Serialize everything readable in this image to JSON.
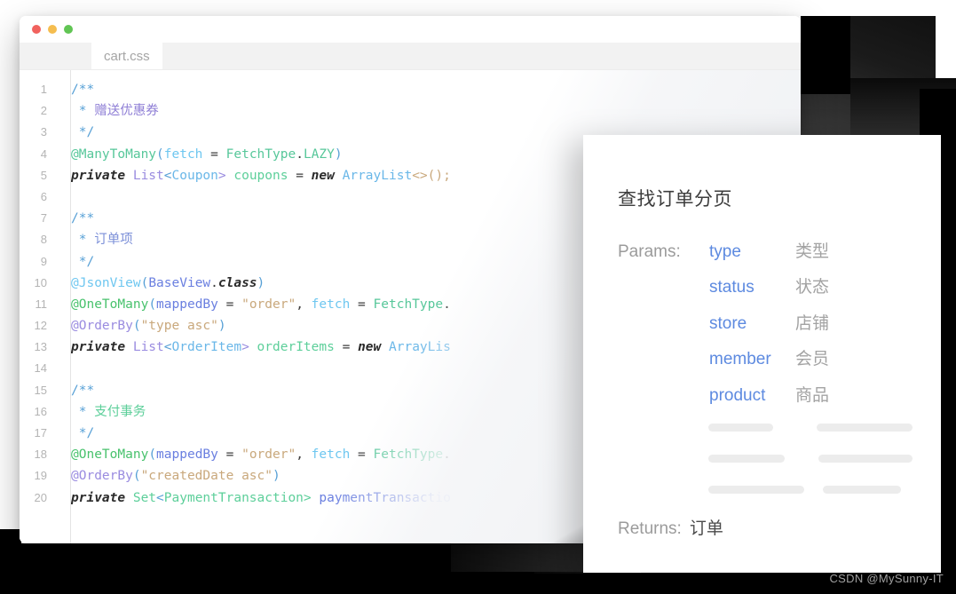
{
  "window": {
    "traffic_lights": [
      {
        "name": "close",
        "color": "#f1625e"
      },
      {
        "name": "minimize",
        "color": "#f5bd4f"
      },
      {
        "name": "maximize",
        "color": "#61c554"
      }
    ],
    "active_tab": "cart.css"
  },
  "editor": {
    "language": "java",
    "line_count": 20,
    "lines": [
      {
        "n": "1",
        "tokens": [
          {
            "t": "/**",
            "c": "t-punc"
          }
        ]
      },
      {
        "n": "2",
        "tokens": [
          {
            "t": " * ",
            "c": "t-punc"
          },
          {
            "t": "赠送优惠券",
            "c": "t-cmtcn"
          }
        ]
      },
      {
        "n": "3",
        "tokens": [
          {
            "t": " */",
            "c": "t-punc"
          }
        ]
      },
      {
        "n": "4",
        "tokens": [
          {
            "t": "@ManyToMany",
            "c": "t-ann"
          },
          {
            "t": "(",
            "c": "t-punc"
          },
          {
            "t": "fetch",
            "c": "t-ann2"
          },
          {
            "t": " = ",
            "c": "t-op"
          },
          {
            "t": "FetchType",
            "c": "t-ann"
          },
          {
            "t": ".",
            "c": "t-op"
          },
          {
            "t": "LAZY",
            "c": "t-ann"
          },
          {
            "t": ")",
            "c": "t-punc"
          }
        ]
      },
      {
        "n": "5",
        "tokens": [
          {
            "t": "private",
            "c": "t-kw"
          },
          {
            "t": " ",
            "c": "t-plain"
          },
          {
            "t": "List",
            "c": "t-type"
          },
          {
            "t": "<",
            "c": "t-punc"
          },
          {
            "t": "Coupon",
            "c": "t-type2"
          },
          {
            "t": ">",
            "c": "t-type"
          },
          {
            "t": " ",
            "c": "t-plain"
          },
          {
            "t": "coupons",
            "c": "t-var"
          },
          {
            "t": " = ",
            "c": "t-op"
          },
          {
            "t": "new",
            "c": "t-kw"
          },
          {
            "t": " ",
            "c": "t-plain"
          },
          {
            "t": "ArrayList",
            "c": "t-type2"
          },
          {
            "t": "<>();",
            "c": "t-str"
          }
        ]
      },
      {
        "n": "6",
        "tokens": []
      },
      {
        "n": "7",
        "tokens": [
          {
            "t": "/**",
            "c": "t-punc"
          }
        ]
      },
      {
        "n": "8",
        "tokens": [
          {
            "t": " * ",
            "c": "t-punc"
          },
          {
            "t": "订单项",
            "c": "t-cmtcn2"
          }
        ]
      },
      {
        "n": "9",
        "tokens": [
          {
            "t": " */",
            "c": "t-punc"
          }
        ]
      },
      {
        "n": "10",
        "tokens": [
          {
            "t": "@JsonView",
            "c": "t-ann2"
          },
          {
            "t": "(",
            "c": "t-punc"
          },
          {
            "t": "BaseView",
            "c": "t-var2"
          },
          {
            "t": ".",
            "c": "t-op"
          },
          {
            "t": "class",
            "c": "t-kw"
          },
          {
            "t": ")",
            "c": "t-punc"
          }
        ]
      },
      {
        "n": "11",
        "tokens": [
          {
            "t": "@OneToMany",
            "c": "t-ann3"
          },
          {
            "t": "(",
            "c": "t-punc"
          },
          {
            "t": "mappedBy",
            "c": "t-var2"
          },
          {
            "t": " = ",
            "c": "t-op"
          },
          {
            "t": "\"order\"",
            "c": "t-str"
          },
          {
            "t": ", ",
            "c": "t-op"
          },
          {
            "t": "fetch",
            "c": "t-ann2"
          },
          {
            "t": " = ",
            "c": "t-op"
          },
          {
            "t": "FetchType",
            "c": "t-ann"
          },
          {
            "t": ".",
            "c": "t-op"
          }
        ]
      },
      {
        "n": "12",
        "tokens": [
          {
            "t": "@OrderBy",
            "c": "t-ann4"
          },
          {
            "t": "(",
            "c": "t-punc"
          },
          {
            "t": "\"type asc\"",
            "c": "t-str"
          },
          {
            "t": ")",
            "c": "t-punc"
          }
        ]
      },
      {
        "n": "13",
        "tokens": [
          {
            "t": "private",
            "c": "t-kw"
          },
          {
            "t": " ",
            "c": "t-plain"
          },
          {
            "t": "List",
            "c": "t-type"
          },
          {
            "t": "<",
            "c": "t-punc"
          },
          {
            "t": "OrderItem",
            "c": "t-type2"
          },
          {
            "t": ">",
            "c": "t-type"
          },
          {
            "t": " ",
            "c": "t-plain"
          },
          {
            "t": "orderItems",
            "c": "t-var"
          },
          {
            "t": " = ",
            "c": "t-op"
          },
          {
            "t": "new",
            "c": "t-kw"
          },
          {
            "t": " ",
            "c": "t-plain"
          },
          {
            "t": "ArrayLis",
            "c": "t-type2"
          }
        ]
      },
      {
        "n": "14",
        "tokens": []
      },
      {
        "n": "15",
        "tokens": [
          {
            "t": "/**",
            "c": "t-punc"
          }
        ]
      },
      {
        "n": "16",
        "tokens": [
          {
            "t": " * ",
            "c": "t-punc"
          },
          {
            "t": "支付事务",
            "c": "t-cmtcn3"
          }
        ]
      },
      {
        "n": "17",
        "tokens": [
          {
            "t": " */",
            "c": "t-punc"
          }
        ]
      },
      {
        "n": "18",
        "tokens": [
          {
            "t": "@OneToMany",
            "c": "t-ann3"
          },
          {
            "t": "(",
            "c": "t-punc"
          },
          {
            "t": "mappedBy",
            "c": "t-var2"
          },
          {
            "t": " = ",
            "c": "t-op"
          },
          {
            "t": "\"order\"",
            "c": "t-str"
          },
          {
            "t": ", ",
            "c": "t-op"
          },
          {
            "t": "fetch",
            "c": "t-ann2"
          },
          {
            "t": " = ",
            "c": "t-op"
          },
          {
            "t": "FetchType",
            "c": "t-ann"
          },
          {
            "t": ".",
            "c": "t-op"
          }
        ]
      },
      {
        "n": "19",
        "tokens": [
          {
            "t": "@OrderBy",
            "c": "t-ann4"
          },
          {
            "t": "(",
            "c": "t-punc"
          },
          {
            "t": "\"createdDate asc\"",
            "c": "t-str"
          },
          {
            "t": ")",
            "c": "t-punc"
          }
        ]
      },
      {
        "n": "20",
        "tokens": [
          {
            "t": "private",
            "c": "t-kw"
          },
          {
            "t": " ",
            "c": "t-plain"
          },
          {
            "t": "Set",
            "c": "t-type3"
          },
          {
            "t": "<",
            "c": "t-punc"
          },
          {
            "t": "PaymentTransaction",
            "c": "t-type3"
          },
          {
            "t": ">",
            "c": "t-type3"
          },
          {
            "t": " ",
            "c": "t-plain"
          },
          {
            "t": "paymentTransactio",
            "c": "t-var2"
          }
        ]
      }
    ]
  },
  "doc_card": {
    "title": "查找订单分页",
    "params_label": "Params:",
    "params": [
      {
        "key": "type",
        "cn": "类型"
      },
      {
        "key": "status",
        "cn": "状态"
      },
      {
        "key": "store",
        "cn": "店铺"
      },
      {
        "key": "member",
        "cn": "会员"
      },
      {
        "key": "product",
        "cn": "商品"
      }
    ],
    "skeleton_rows": [
      {
        "left_width": 81,
        "gap": 49,
        "right_width": 120
      },
      {
        "left_width": 91,
        "gap": 38,
        "right_width": 113
      },
      {
        "left_width": 108,
        "gap": 21,
        "right_width": 88
      }
    ],
    "returns_label": "Returns:",
    "returns_value": "订单"
  },
  "watermark": "CSDN @MySunny-IT",
  "colors": {
    "accent_blue": "#5d8ae0",
    "muted_gray": "#9b9b9b",
    "skeleton_gray": "#ececec",
    "tab_active_bg": "#ffffff",
    "tabstrip_bg": "#f2f2f2"
  }
}
